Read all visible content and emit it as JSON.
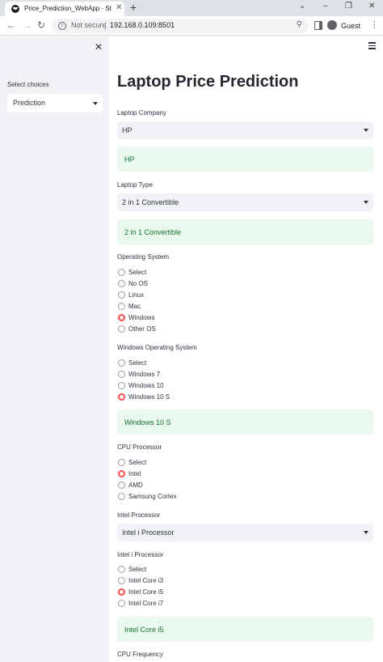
{
  "browser": {
    "tab_title": "Price_Prediction_WebApp · Strea",
    "address_security": "Not secure",
    "url": "192.168.0.109:8501",
    "profile": "Guest"
  },
  "sidebar": {
    "label": "Select choices",
    "selected": "Prediction"
  },
  "main": {
    "title": "Laptop Price Prediction",
    "company": {
      "label": "Laptop Company",
      "value": "HP",
      "success": "HP"
    },
    "type": {
      "label": "Laptop Type",
      "value": "2 in 1 Convertible",
      "success": "2 in 1 Convertible"
    },
    "os": {
      "label": "Operating System",
      "options": [
        "Select",
        "No OS",
        "Linux",
        "Mac",
        "Windows",
        "Other OS"
      ],
      "selected": "Windows"
    },
    "win_os": {
      "label": "Windows Operating System",
      "options": [
        "Select",
        "Windows 7",
        "Windows 10",
        "Windows 10 S"
      ],
      "selected": "Windows 10 S",
      "success": "Windows 10 S"
    },
    "cpu": {
      "label": "CPU Processor",
      "options": [
        "Select",
        "Intel",
        "AMD",
        "Samsung Cortex"
      ],
      "selected": "Intel"
    },
    "intel": {
      "label": "Intel Processor",
      "value": "Intel i Processor"
    },
    "intel_i": {
      "label": "Intel i Processor",
      "options": [
        "Select",
        "Intel Core i3",
        "Intel Core i5",
        "Intel Core i7"
      ],
      "selected": "Intel Core i5",
      "success": "Intel Core i5"
    },
    "cpu_freq": {
      "label": "CPU Frequency"
    }
  }
}
